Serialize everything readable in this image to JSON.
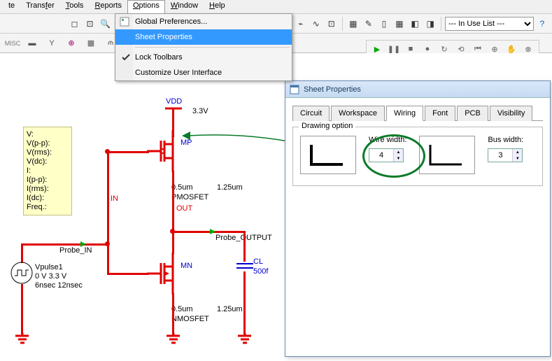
{
  "menubar": [
    "te",
    "Transfer",
    "Tools",
    "Reports",
    "Options",
    "Window",
    "Help"
  ],
  "menu_underline_idx": [
    -1,
    5,
    0,
    0,
    0,
    0,
    0
  ],
  "dropdown": {
    "items": [
      "Global Preferences...",
      "Sheet Properties",
      "Lock Toolbars",
      "Customize User Interface"
    ],
    "highlighted": 1,
    "checked": 2
  },
  "in_use_list": "--- In Use List ---",
  "circuit": {
    "vdd": "VDD",
    "vdd_val": "3.3V",
    "in": "IN",
    "out": "OUT",
    "mp": "MP",
    "mn": "MN",
    "pmos_w": "0.5um",
    "pmos_l": "1.25um",
    "pmos_type": "PMOSFET",
    "nmos_w": "0.5um",
    "nmos_l": "1.25um",
    "nmos_type": "NMOSFET",
    "probe_in": "Probe_IN",
    "probe_out": "Probe_OUTPUT",
    "cl": "CL",
    "cl_val": "500f",
    "vpulse_name": "Vpulse1",
    "vpulse_v": "0 V 3.3 V",
    "vpulse_t": "6nsec 12nsec"
  },
  "meter": {
    "lines": [
      "V:",
      "V(p-p):",
      "V(rms):",
      "V(dc):",
      "I:",
      "I(p-p):",
      "I(rms):",
      "I(dc):",
      "Freq.:"
    ]
  },
  "props": {
    "title": "Sheet Properties",
    "tabs": [
      "Circuit",
      "Workspace",
      "Wiring",
      "Font",
      "PCB",
      "Visibility"
    ],
    "active_tab": 2,
    "legend": "Drawing option",
    "wire_width_label": "Wire width:",
    "wire_width_val": "4",
    "bus_width_label": "Bus width:",
    "bus_width_val": "3"
  }
}
